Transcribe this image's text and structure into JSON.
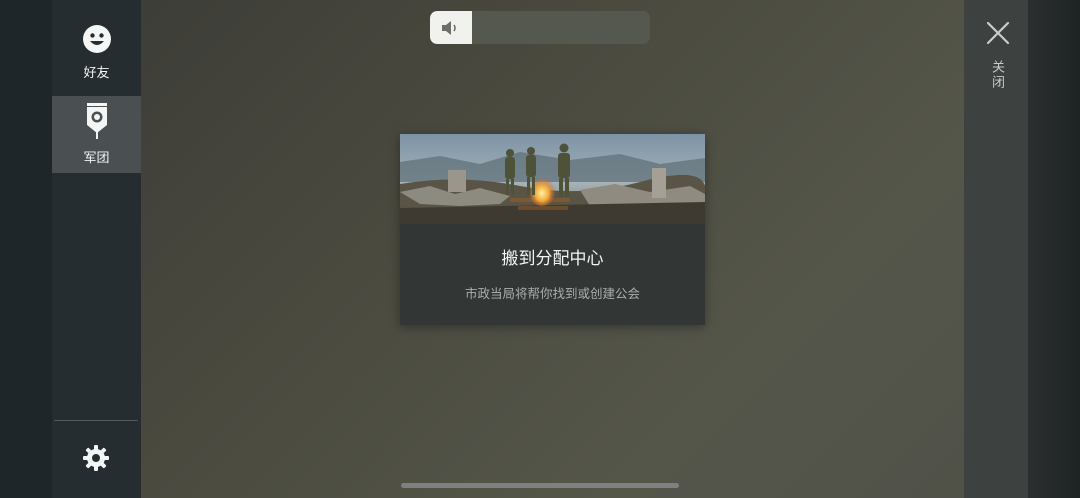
{
  "sidebar": {
    "items": [
      {
        "label": "好友",
        "icon": "smiley-face-icon"
      },
      {
        "label": "军团",
        "icon": "legion-banner-icon"
      }
    ],
    "settings_icon": "gear-icon"
  },
  "volume": {
    "level_percent": 19,
    "icon": "speaker-icon"
  },
  "card": {
    "title": "搬到分配中心",
    "subtitle": "市政当局将帮你找到或创建公会",
    "image": "soldiers-around-campfire-illustration"
  },
  "right_panel": {
    "close_label": "关闭",
    "close_icon": "close-icon"
  }
}
